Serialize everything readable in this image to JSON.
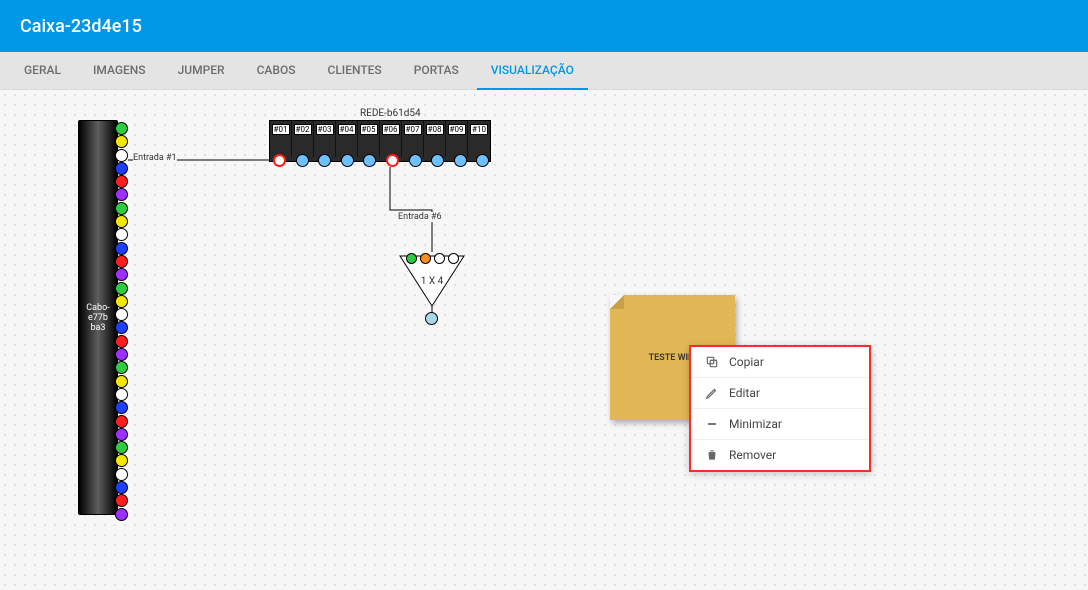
{
  "header": {
    "title": "Caixa-23d4e15"
  },
  "tabs": [
    {
      "label": "GERAL",
      "active": false
    },
    {
      "label": "IMAGENS",
      "active": false
    },
    {
      "label": "JUMPER",
      "active": false
    },
    {
      "label": "CABOS",
      "active": false
    },
    {
      "label": "CLIENTES",
      "active": false
    },
    {
      "label": "PORTAS",
      "active": false
    },
    {
      "label": "VISUALIZAÇÃO",
      "active": true
    }
  ],
  "cable": {
    "label": "Cabo-e77b\nba3",
    "fibers": [
      "green",
      "yellow",
      "white",
      "blue",
      "red",
      "violet",
      "green",
      "yellow",
      "white",
      "blue",
      "red",
      "violet",
      "green",
      "yellow",
      "white",
      "blue",
      "red",
      "violet",
      "green",
      "yellow",
      "white",
      "blue",
      "red",
      "violet",
      "green",
      "yellow",
      "white",
      "blue",
      "red",
      "violet"
    ]
  },
  "entry_labels": {
    "one": "Entrada #1",
    "six": "Entrada #6"
  },
  "rede": {
    "name": "REDE-b61d54",
    "ports": [
      "#01",
      "#02",
      "#03",
      "#04",
      "#05",
      "#06",
      "#07",
      "#08",
      "#09",
      "#10"
    ],
    "port_dots": [
      "open",
      "lblue",
      "lblue",
      "lblue",
      "lblue",
      "open",
      "lblue",
      "lblue",
      "lblue",
      "lblue"
    ]
  },
  "splitter": {
    "label": "1 X 4",
    "inputs": [
      "green",
      "orange",
      "white",
      "white"
    ]
  },
  "note": {
    "text": "TESTE WIKI"
  },
  "context_menu": [
    {
      "icon": "copy-icon",
      "label": "Copiar"
    },
    {
      "icon": "edit-icon",
      "label": "Editar"
    },
    {
      "icon": "minimize-icon",
      "label": "Minimizar"
    },
    {
      "icon": "delete-icon",
      "label": "Remover"
    }
  ]
}
